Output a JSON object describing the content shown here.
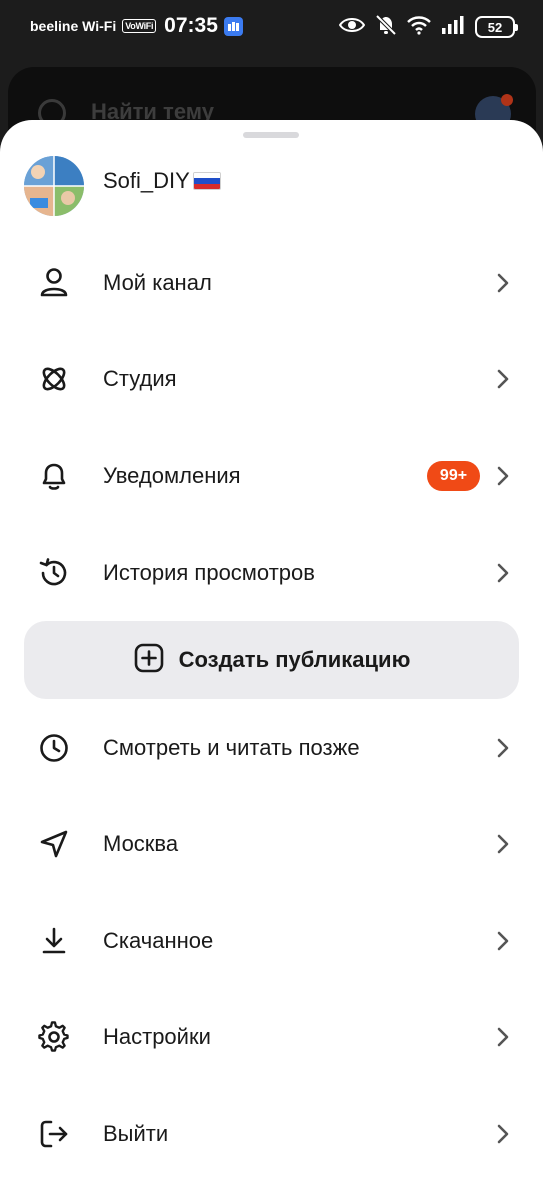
{
  "status_bar": {
    "carrier": "beeline Wi-Fi",
    "vowifi": "VoWiFi",
    "time": "07:35",
    "battery": "52",
    "icons": [
      "eye-icon",
      "bell-off-icon",
      "wifi-icon",
      "signal-icon",
      "battery-icon"
    ]
  },
  "background": {
    "search_placeholder": "Найти тему"
  },
  "profile": {
    "username": "Sofi_DIY",
    "flag": "russia-flag"
  },
  "menu": {
    "items": [
      {
        "label": "Мой канал",
        "icon": "person-icon"
      },
      {
        "label": "Студия",
        "icon": "orbit-icon"
      },
      {
        "label": "Уведомления",
        "icon": "bell-icon",
        "badge": "99+"
      },
      {
        "label": "История просмотров",
        "icon": "history-icon"
      },
      {
        "label": "Смотреть и читать позже",
        "icon": "clock-icon"
      },
      {
        "label": "Москва",
        "icon": "location-arrow-icon"
      },
      {
        "label": "Скачанное",
        "icon": "download-icon"
      },
      {
        "label": "Настройки",
        "icon": "gear-icon"
      },
      {
        "label": "Выйти",
        "icon": "logout-icon"
      }
    ]
  },
  "create_button": {
    "label": "Создать публикацию",
    "icon": "plus-square-icon"
  },
  "colors": {
    "badge": "#f04a16",
    "button_bg": "#ebebee",
    "text": "#1a1a1a",
    "chevron": "#555555"
  }
}
